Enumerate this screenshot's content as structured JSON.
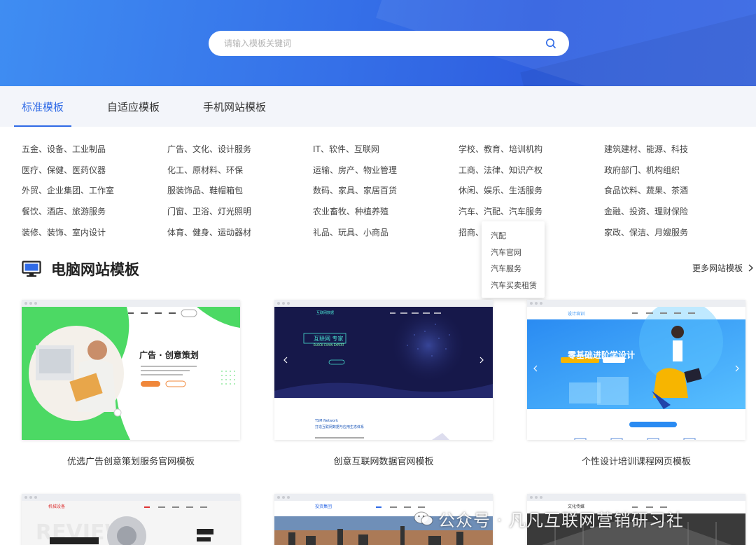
{
  "search": {
    "placeholder": "请输入模板关键词",
    "value": ""
  },
  "tabs": [
    {
      "label": "标准模板",
      "active": true
    },
    {
      "label": "自适应模板",
      "active": false
    },
    {
      "label": "手机网站模板",
      "active": false
    }
  ],
  "categories": [
    [
      "五金、设备、工业制品",
      "广告、文化、设计服务",
      "IT、软件、互联网",
      "学校、教育、培训机构",
      "建筑建材、能源、科技"
    ],
    [
      "医疗、保健、医药仪器",
      "化工、原材料、环保",
      "运输、房产、物业管理",
      "工商、法律、知识产权",
      "政府部门、机构组织"
    ],
    [
      "外贸、企业集团、工作室",
      "服装饰品、鞋帽箱包",
      "数码、家具、家居百货",
      "休闲、娱乐、生活服务",
      "食品饮料、蔬果、茶酒"
    ],
    [
      "餐饮、酒店、旅游服务",
      "门窗、卫浴、灯光照明",
      "农业畜牧、种植养殖",
      "汽车、汽配、汽车服务",
      "金融、投资、理财保险"
    ],
    [
      "装修、装饰、室内设计",
      "体育、健身、运动器材",
      "礼品、玩具、小商品",
      "招商、营销、广告策划",
      "家政、保洁、月嫂服务"
    ]
  ],
  "dropdown": {
    "items": [
      "汽配",
      "汽车官网",
      "汽车服务",
      "汽车买卖租赁"
    ]
  },
  "section": {
    "title": "电脑网站模板",
    "more_label": "更多网站模板"
  },
  "cards": [
    {
      "caption": "优选广告创意策划服务官网模板",
      "hero_text": "广告 · 创意策划",
      "btn1": "",
      "btn2": ""
    },
    {
      "caption": "创意互联网数据官网模板",
      "logo": "互联网数据",
      "hero_title": "互联网 专家",
      "hero_sub": "BLOCK CHAIN EXPERT",
      "sub_title": "TSM Network",
      "sub_text": "打造互联网数据与应用生态体系"
    },
    {
      "caption": "个性设计培训课程网页模板",
      "hero_title": "零基础进阶学设计",
      "logo": "设计培训"
    },
    {
      "caption": "",
      "logo": "机械设备"
    },
    {
      "caption": "",
      "logo": "投资集团"
    },
    {
      "caption": "",
      "logo": "文化传媒"
    }
  ],
  "colors": {
    "accent": "#2f6ae6",
    "banner": "#3570e8",
    "green": "#4cd964",
    "navy": "#16184a"
  },
  "watermark": {
    "text": "公众号 · 凡凡互联网营销研习社"
  }
}
